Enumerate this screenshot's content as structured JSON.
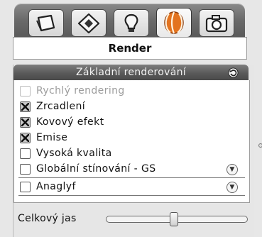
{
  "tabs": [
    {
      "icon": "object-icon",
      "active": false
    },
    {
      "icon": "material-icon",
      "active": false
    },
    {
      "icon": "light-icon",
      "active": false
    },
    {
      "icon": "render-icon",
      "active": true
    },
    {
      "icon": "camera-icon",
      "active": false
    }
  ],
  "section": {
    "title": "Render"
  },
  "basic_render": {
    "header": "Základní renderování",
    "options": [
      {
        "label": "Rychlý rendering",
        "checked": false,
        "disabled": true
      },
      {
        "label": "Zrcadlení",
        "checked": true,
        "disabled": false
      },
      {
        "label": "Kovový efekt",
        "checked": true,
        "disabled": false
      },
      {
        "label": "Emise",
        "checked": true,
        "disabled": false
      },
      {
        "label": "Vysoká  kvalita",
        "checked": false,
        "disabled": false
      },
      {
        "label": "Globální stínování - GS",
        "checked": false,
        "disabled": false,
        "expandable": true
      },
      {
        "label": "Anaglyf",
        "checked": false,
        "disabled": false,
        "expandable": true
      }
    ],
    "brightness": {
      "label": "Celkový jas",
      "value": 0.48
    }
  },
  "colors": {
    "header_bg": "#5a5a5a",
    "accent_orange": "#e3731f"
  }
}
